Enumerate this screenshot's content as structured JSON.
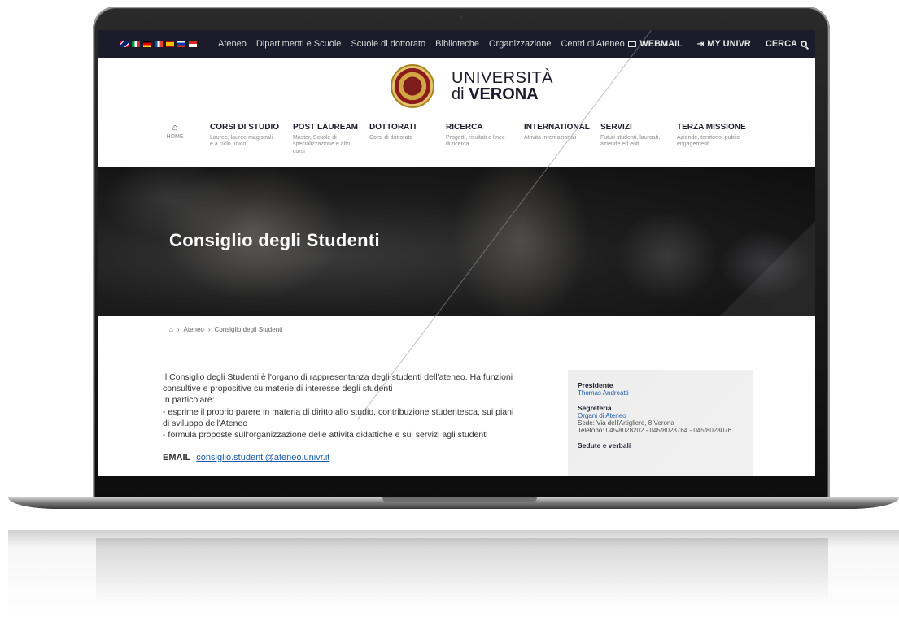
{
  "topbar": {
    "flags": [
      "gb",
      "it",
      "de",
      "fr",
      "es",
      "ru",
      "x"
    ],
    "nav": [
      "Ateneo",
      "Dipartimenti e Scuole",
      "Scuole di dottorato",
      "Biblioteche",
      "Organizzazione",
      "Centri di Ateneo"
    ],
    "webmail": "WEBMAIL",
    "myunivr": "MY UNIVR",
    "cerca": "CERCA"
  },
  "logo": {
    "line1": "UNIVERSITÀ",
    "line2_prefix": "di ",
    "line2_bold": "VERONA"
  },
  "mainnav": {
    "home": {
      "title": "HOME"
    },
    "items": [
      {
        "title": "CORSI DI STUDIO",
        "sub": "Lauree, lauree magistrali e a ciclo unico"
      },
      {
        "title": "POST LAUREAM",
        "sub": "Master, Scuole di specializzazione e altri corsi"
      },
      {
        "title": "DOTTORATI",
        "sub": "Corsi di dottorato"
      },
      {
        "title": "RICERCA",
        "sub": "Progetti, risultati e linee di ricerca"
      },
      {
        "title": "INTERNATIONAL",
        "sub": "Attività internazionali"
      },
      {
        "title": "SERVIZI",
        "sub": "Futuri studenti, laureati, aziende ed enti"
      },
      {
        "title": "TERZA MISSIONE",
        "sub": "Aziende, territorio, public engagement"
      }
    ]
  },
  "hero": {
    "title": "Consiglio degli Studenti"
  },
  "breadcrumb": {
    "level1": "Ateneo",
    "level2": "Consiglio degli Studenti"
  },
  "content": {
    "para1": "Il Consiglio degli Studenti è l'organo di rappresentanza degli studenti dell'ateneo. Ha funzioni consultive e propositive su materie di interesse degli studenti",
    "para2": "In particolare:",
    "para3": "- esprime il proprio parere in materia di diritto allo studio, contribuzione studentesca, sui piani di sviluppo dell'Ateneo",
    "para4": "- formula proposte sull'organizzazione delle attività didattiche e sui servizi agli studenti",
    "email_label": "EMAIL",
    "email": "consiglio.studenti@ateneo.univr.it"
  },
  "sidebar": {
    "presidente_label": "Presidente",
    "presidente": "Thomas Andreatti",
    "segreteria_label": "Segreteria",
    "segreteria_link": "Organi di Ateneo",
    "sede": "Sede: Via dell'Artigliere, 8 Verona",
    "telefono": "Telefono: 045/8028202 - 045/8028764 - 045/8028076",
    "sedute_label": "Sedute e verbali"
  },
  "colors": {
    "topbar": "#1b1b2b",
    "link": "#1a5aa8",
    "sidebar_bg": "#eeeeee"
  }
}
